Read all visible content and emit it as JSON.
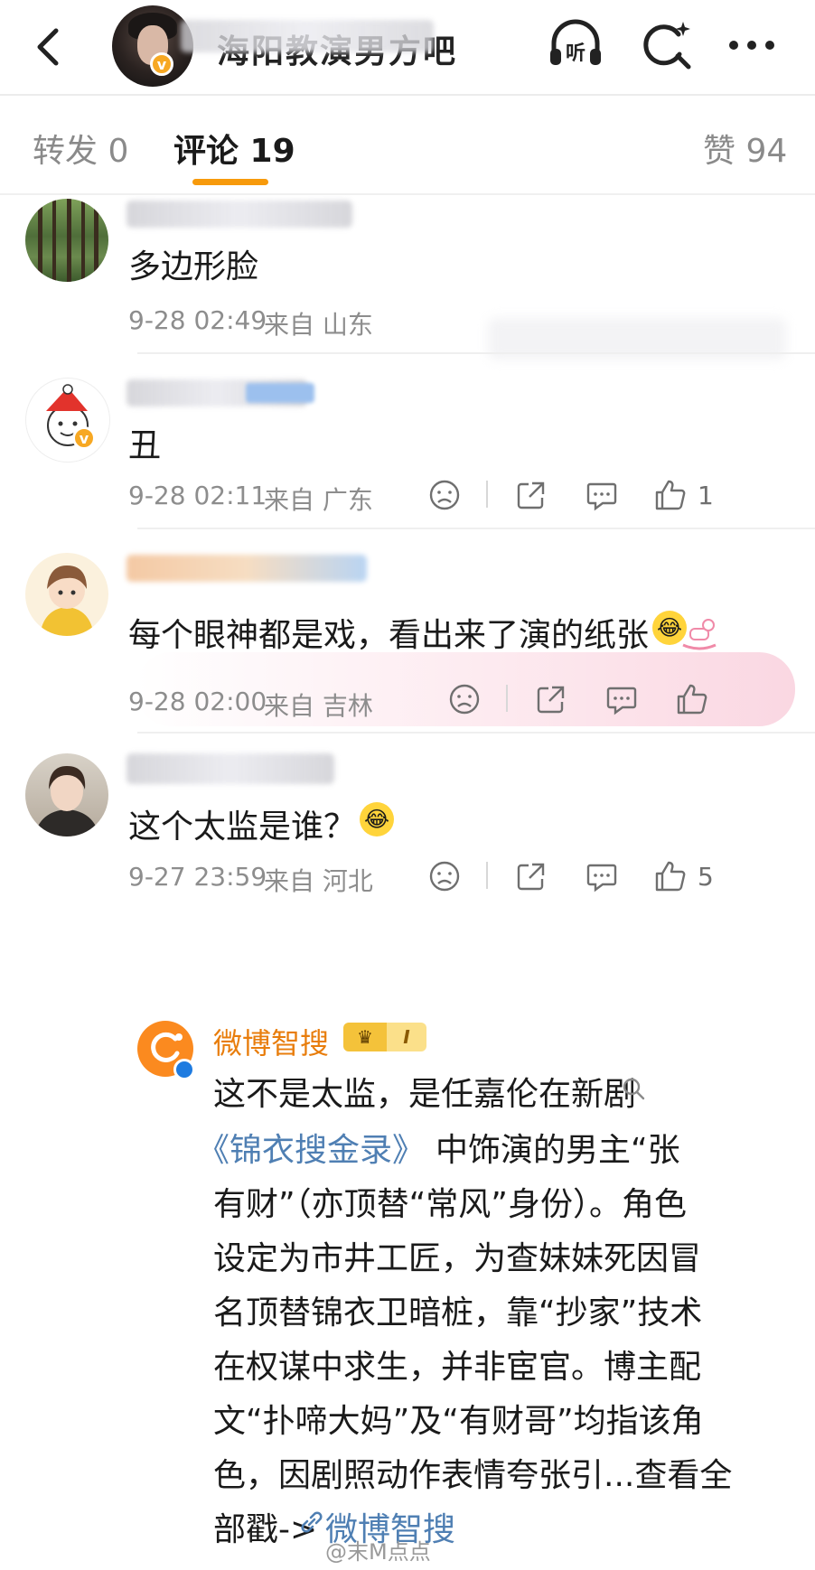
{
  "header": {
    "title": "海阳教演男方吧",
    "listen_label": "听",
    "verified_mark": "v"
  },
  "tabs": {
    "reposts": "转发 0",
    "comments": "评论 19",
    "likes": "赞 94"
  },
  "comments": [
    {
      "text": "多边形脸",
      "date": "9-28 02:49",
      "source": "来自 山东"
    },
    {
      "text": "丑",
      "date": "9-28 02:11",
      "source": "来自 广东",
      "like_count": "1"
    },
    {
      "text": "每个眼神都是戏，看出来了演的纸张",
      "date": "9-28 02:00",
      "source": "来自 吉林"
    },
    {
      "text": "这个太监是谁？",
      "date": "9-27 23:59",
      "source": "来自 河北",
      "like_count": "5"
    }
  ],
  "reply": {
    "author": "微博智搜",
    "badge_level": "I",
    "lines": [
      "这不是太监，是任嘉伦在新剧",
      "《锦衣搜金录》",
      "中饰演的男主“张",
      "有财”（亦顶替“常风”身份）。角色",
      "设定为市井工匠，为查妹妹死因冒",
      "名顶替锦衣卫暗桩，靠“抄家”技术",
      "在权谋中求生，并非宦官。博主配",
      "文“扑啼大妈”及“有财哥”均指该角",
      "色，因剧照动作表情夸张引...查看全",
      "部戳->",
      "微博智搜"
    ]
  },
  "watermark": "@末M点点",
  "colors": {
    "accent": "#f79a0c",
    "link": "#4f7fb3",
    "meta_gray": "#8d8d8d",
    "verified": "#f7a823"
  },
  "icons": [
    "back-icon",
    "listen-icon",
    "search-icon",
    "more-icon",
    "dislike-icon",
    "share-icon",
    "comment-icon",
    "like-icon",
    "search-link-icon",
    "link-icon"
  ]
}
